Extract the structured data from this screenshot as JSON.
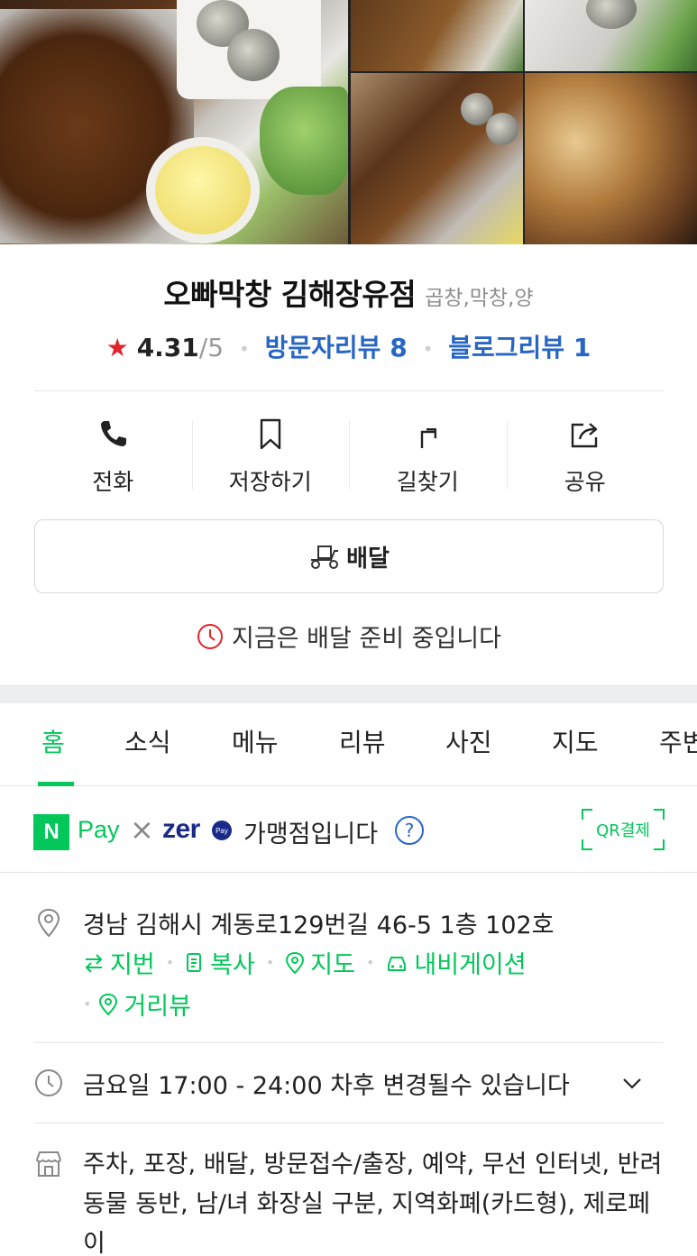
{
  "store": {
    "name": "오빠막창 김해장유점",
    "category": "곱창,막창,양",
    "rating": "4.31",
    "rating_max": "/5",
    "visitor_reviews": "방문자리뷰 8",
    "blog_reviews": "블로그리뷰 1"
  },
  "actions": [
    {
      "label": "전화",
      "icon": "phone-icon"
    },
    {
      "label": "저장하기",
      "icon": "bookmark-icon"
    },
    {
      "label": "길찾기",
      "icon": "directions-icon"
    },
    {
      "label": "공유",
      "icon": "share-icon"
    }
  ],
  "delivery": {
    "button_label": "배달",
    "status": "지금은 배달 준비 중입니다"
  },
  "tabs": [
    "홈",
    "소식",
    "메뉴",
    "리뷰",
    "사진",
    "지도",
    "주변"
  ],
  "npay": {
    "n_letter": "N",
    "pay_word": "Pay",
    "times": "×",
    "zero_word": "zer",
    "zero_pay": "Pay",
    "text": "가맹점입니다",
    "help": "?",
    "qr_label": "QR결제"
  },
  "address": {
    "text": "경남 김해시 계동로129번길 46-5 1층 102호",
    "links": [
      "지번",
      "복사",
      "지도",
      "내비게이션",
      "거리뷰"
    ]
  },
  "hours": {
    "text": "금요일 17:00 - 24:00 차후 변경될수 있습니다"
  },
  "amenities": {
    "text": "주차, 포장, 배달, 방문접수/출장, 예약, 무선 인터넷, 반려동물 동반, 남/녀 화장실 구분, 지역화폐(카드형), 제로페이"
  },
  "colors": {
    "accent_green": "#03c75a",
    "link_blue": "#2866c6",
    "star_red": "#e0242c"
  }
}
